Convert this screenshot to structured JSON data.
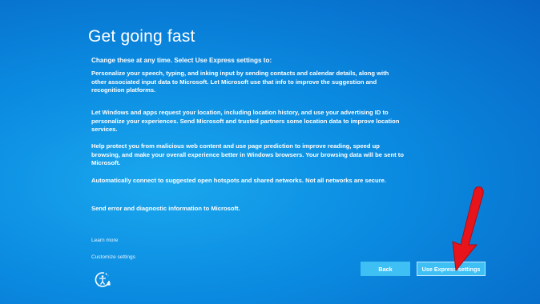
{
  "title": "Get going fast",
  "intro": "Change these at any time. Select Use Express settings to:",
  "paragraphs": [
    "Personalize your speech, typing, and inking input by sending contacts and calendar details, along with other associated input data to Microsoft. Let Microsoft use that info to improve the suggestion and recognition platforms.",
    "Let Windows and apps request your location, including location history, and use your advertising ID to personalize your experiences. Send Microsoft and trusted partners some location data to improve location services.",
    "Help protect you from malicious web content and use page prediction to improve reading, speed up browsing, and make your overall experience better in Windows browsers. Your browsing data will be sent to Microsoft.",
    "Automatically connect to suggested open hotspots and shared networks. Not all networks are secure.",
    "Send error and diagnostic information to Microsoft."
  ],
  "links": {
    "learn_more": "Learn more",
    "customize": "Customize settings"
  },
  "buttons": {
    "back": "Back",
    "express": "Use Express settings"
  },
  "icons": {
    "ease_of_access": "ease-of-access-icon",
    "annotation_arrow": "red-arrow"
  },
  "colors": {
    "background": "#0a8ae0",
    "button": "#3ec0f5",
    "arrow": "#e8141c"
  }
}
